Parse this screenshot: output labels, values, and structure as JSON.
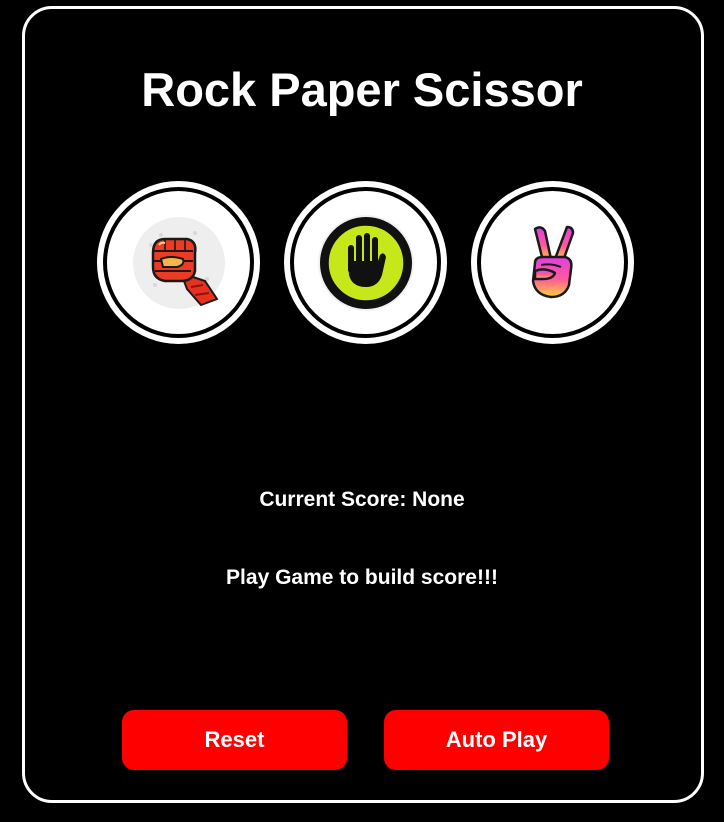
{
  "title": "Rock Paper Scissor",
  "choices": [
    {
      "id": "rock",
      "icon": "fist-icon"
    },
    {
      "id": "paper",
      "icon": "hand-icon"
    },
    {
      "id": "scissors",
      "icon": "peace-hand-icon"
    }
  ],
  "score": {
    "text": "Current Score: None"
  },
  "message": "Play Game to build score!!!",
  "buttons": {
    "reset": "Reset",
    "auto_play": "Auto Play"
  },
  "colors": {
    "background": "#000000",
    "button": "#ff0000",
    "text": "#ffffff",
    "paper_accent": "#c6e81b"
  }
}
